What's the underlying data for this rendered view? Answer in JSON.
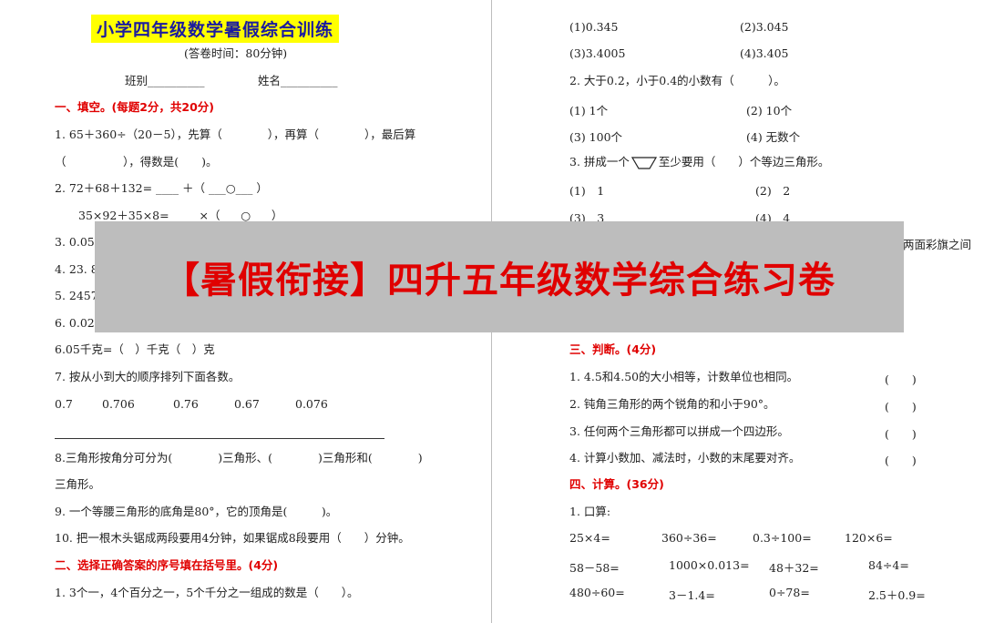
{
  "left": {
    "title": "小学四年级数学暑假综合训练",
    "time": "(答卷时间：80分钟)",
    "class_label": "班别__________",
    "name_label": "姓名__________",
    "sec1": "一、填空。(每题2分，共20分)",
    "q1a": "1. 65＋360÷（20－5），先算（　　　　），再算（　　　　），最后算",
    "q1b": "（　　　　　），得数是(　　)。",
    "q2a": "2. 72＋68＋132= ____ ＋（ ___○___ ）",
    "q2b": "35×92＋35×8= ____ ×（ ___○___ ）",
    "q3": "3. 0.05",
    "q4": "4. 23. 8",
    "q5": "5. 2457",
    "q6": "6. 0.02",
    "q6b": "6.05千克=（　）千克（　）克",
    "q7": "7. 按从小到大的顺序排列下面各数。",
    "q7_nums": [
      "0.7",
      "0.706",
      "0.76",
      "0.67",
      "0.076"
    ],
    "q8a": "8.三角形按角分可分为(　　　　)三角形、(　　　　)三角形和(　　　　)",
    "q8b": "三角形。",
    "q9": "9. 一个等腰三角形的底角是80°，它的顶角是(　　　)。",
    "q10": "10. 把一根木头锯成两段要用4分钟，如果锯成8段要用（　　）分钟。",
    "sec2": "二、选择正确答案的序号填在括号里。(4分)",
    "q11": "1. 3个一，4个百分之一，5个千分之一组成的数是（　　）。"
  },
  "right": {
    "r1": [
      "(1)0.345",
      "(2)3.045"
    ],
    "r2": [
      "(3)3.4005",
      "(4)3.405"
    ],
    "q2": "2. 大于0.2，小于0.4的小数有（　　　）。",
    "r3": [
      "(1) 1个",
      "(2) 10个"
    ],
    "r4": [
      "(3) 100个",
      "(4) 无数个"
    ],
    "q3_pre": "3. 拼成一个",
    "q3_post": "至少要用（　　）个等边三角形。",
    "r5": [
      "(1)　1",
      "(2)　2"
    ],
    "r6": [
      "(3)　3",
      "(4)　4"
    ],
    "cut": "两面彩旗之间",
    "sec3": "三、判断。(4分)",
    "j1": "1. 4.5和4.50的大小相等，计数单位也相同。",
    "j2": "2. 钝角三角形的两个锐角的和小于90°。",
    "j3": "3. 任何两个三角形都可以拼成一个四边形。",
    "j4": "4. 计算小数加、减法时，小数的末尾要对齐。",
    "paren": "(　　)",
    "sec4": "四、计算。(36分)",
    "calc_title": "1. 口算:",
    "calc_rows": [
      [
        "25×4=",
        "360÷36=",
        "0.3÷100=",
        "120×6="
      ],
      [
        "58－58=",
        "1000×0.013=",
        "48＋32=",
        "84÷4="
      ],
      [
        "480÷60=",
        "3－1.4=",
        "0÷78=",
        "2.5＋0.9="
      ]
    ]
  },
  "banner": "【暑假衔接】四升五年级数学综合练习卷"
}
